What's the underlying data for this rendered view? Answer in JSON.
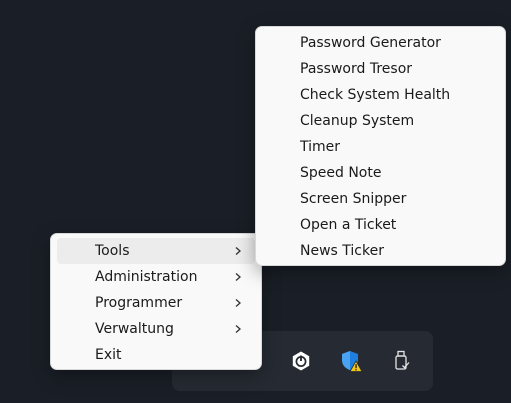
{
  "context_menu": {
    "items": [
      {
        "label": "Tools",
        "has_submenu": true,
        "hovered": true
      },
      {
        "label": "Administration",
        "has_submenu": true,
        "hovered": false
      },
      {
        "label": "Programmer",
        "has_submenu": true,
        "hovered": false
      },
      {
        "label": "Verwaltung",
        "has_submenu": true,
        "hovered": false
      },
      {
        "label": "Exit",
        "has_submenu": false,
        "hovered": false
      }
    ]
  },
  "tools_submenu": {
    "items": [
      {
        "label": "Password Generator"
      },
      {
        "label": "Password Tresor"
      },
      {
        "label": "Check System Health"
      },
      {
        "label": "Cleanup System"
      },
      {
        "label": "Timer"
      },
      {
        "label": "Speed Note"
      },
      {
        "label": "Screen Snipper"
      },
      {
        "label": "Open a Ticket"
      },
      {
        "label": "News Ticker"
      }
    ]
  },
  "tray": {
    "icons": [
      {
        "name": "power-app-icon"
      },
      {
        "name": "security-warning-icon"
      },
      {
        "name": "usb-drive-icon"
      }
    ]
  },
  "colors": {
    "desktop": "#1a1f27",
    "tray_background": "#262b33",
    "menu_background": "#f9f9f9",
    "hover": "#ececec",
    "shield_blue": "#1f7fe0",
    "warning_yellow": "#f5c518"
  }
}
